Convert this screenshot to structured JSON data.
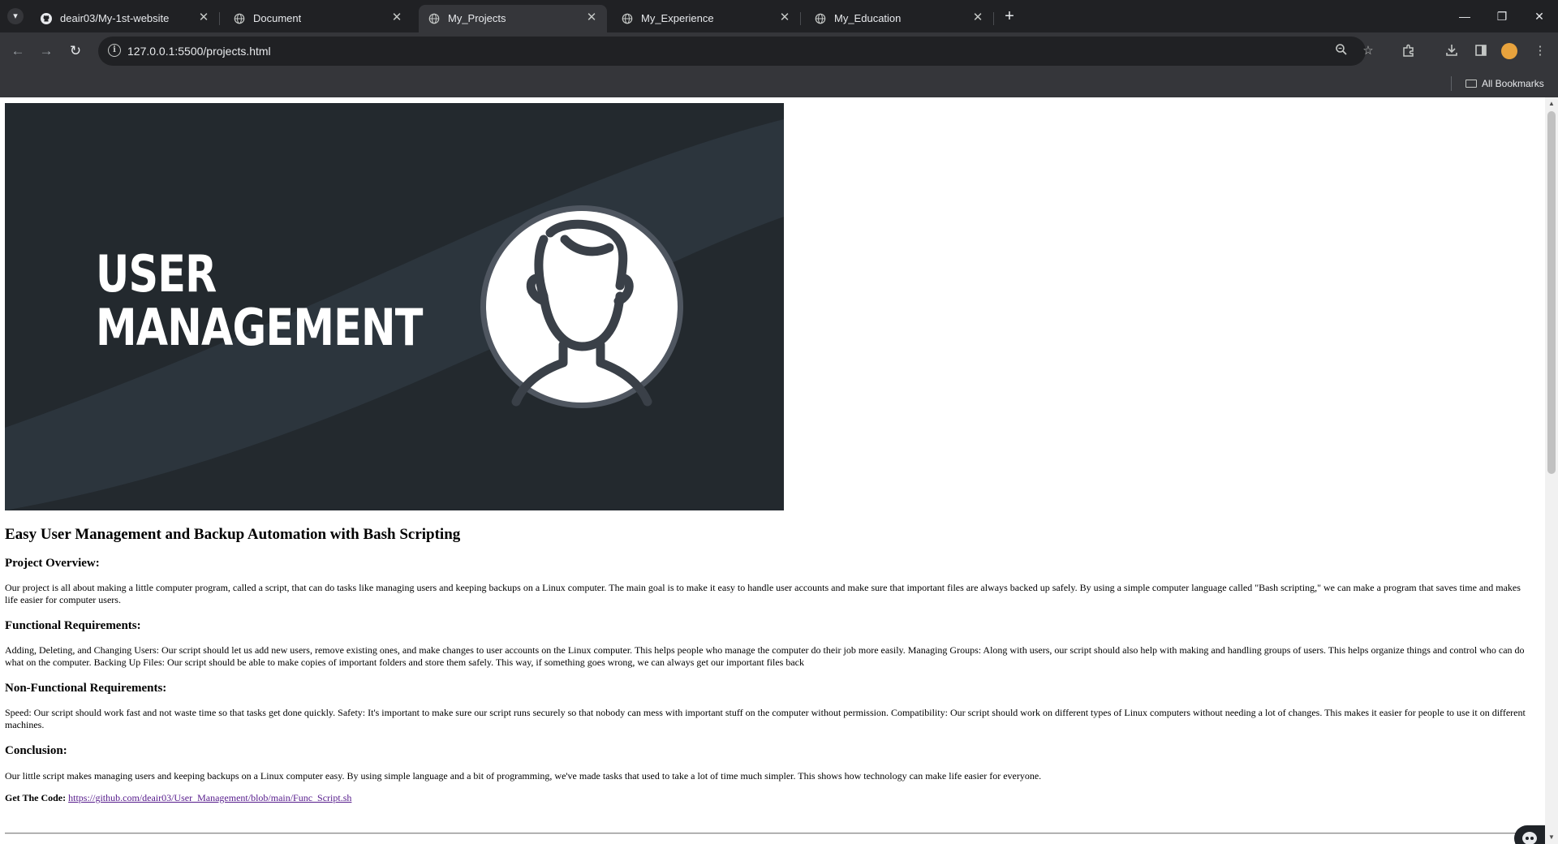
{
  "browser": {
    "tabs": [
      {
        "title": "deair03/My-1st-website",
        "favicon": "github-icon",
        "active": false
      },
      {
        "title": "Document",
        "favicon": "globe-icon",
        "active": false
      },
      {
        "title": "My_Projects",
        "favicon": "globe-icon",
        "active": true
      },
      {
        "title": "My_Experience",
        "favicon": "globe-icon",
        "active": false
      },
      {
        "title": "My_Education",
        "favicon": "globe-icon",
        "active": false
      }
    ],
    "url": "127.0.0.1:5500/projects.html",
    "bookmarks": {
      "all_label": "All Bookmarks"
    }
  },
  "page": {
    "hero_image": {
      "line1": "USER",
      "line2": "MANAGEMENT"
    },
    "title": "Easy User Management and Backup Automation with Bash Scripting",
    "sections": [
      {
        "heading": "Project Overview:",
        "text": "Our project is all about making a little computer program, called a script, that can do tasks like managing users and keeping backups on a Linux computer. The main goal is to make it easy to handle user accounts and make sure that important files are always backed up safely. By using a simple computer language called \"Bash scripting,\" we can make a program that saves time and makes life easier for computer users."
      },
      {
        "heading": "Functional Requirements:",
        "text": "Adding, Deleting, and Changing Users: Our script should let us add new users, remove existing ones, and make changes to user accounts on the Linux computer. This helps people who manage the computer do their job more easily. Managing Groups: Along with users, our script should also help with making and handling groups of users. This helps organize things and control who can do what on the computer. Backing Up Files: Our script should be able to make copies of important folders and store them safely. This way, if something goes wrong, we can always get our important files back"
      },
      {
        "heading": "Non-Functional Requirements:",
        "text": "Speed: Our script should work fast and not waste time so that tasks get done quickly. Safety: It's important to make sure our script runs securely so that nobody can mess with important stuff on the computer without permission. Compatibility: Our script should work on different types of Linux computers without needing a lot of changes. This makes it easier for people to use it on different machines."
      },
      {
        "heading": "Conclusion:",
        "text": "Our little script makes managing users and keeping backups on a Linux computer easy. By using simple language and a bit of programming, we've made tasks that used to take a lot of time much simpler. This shows how technology can make life easier for everyone."
      }
    ],
    "code": {
      "label": "Get The Code:",
      "link": "https://github.com/deair03/User_Management/blob/main/Func_Script.sh"
    }
  }
}
